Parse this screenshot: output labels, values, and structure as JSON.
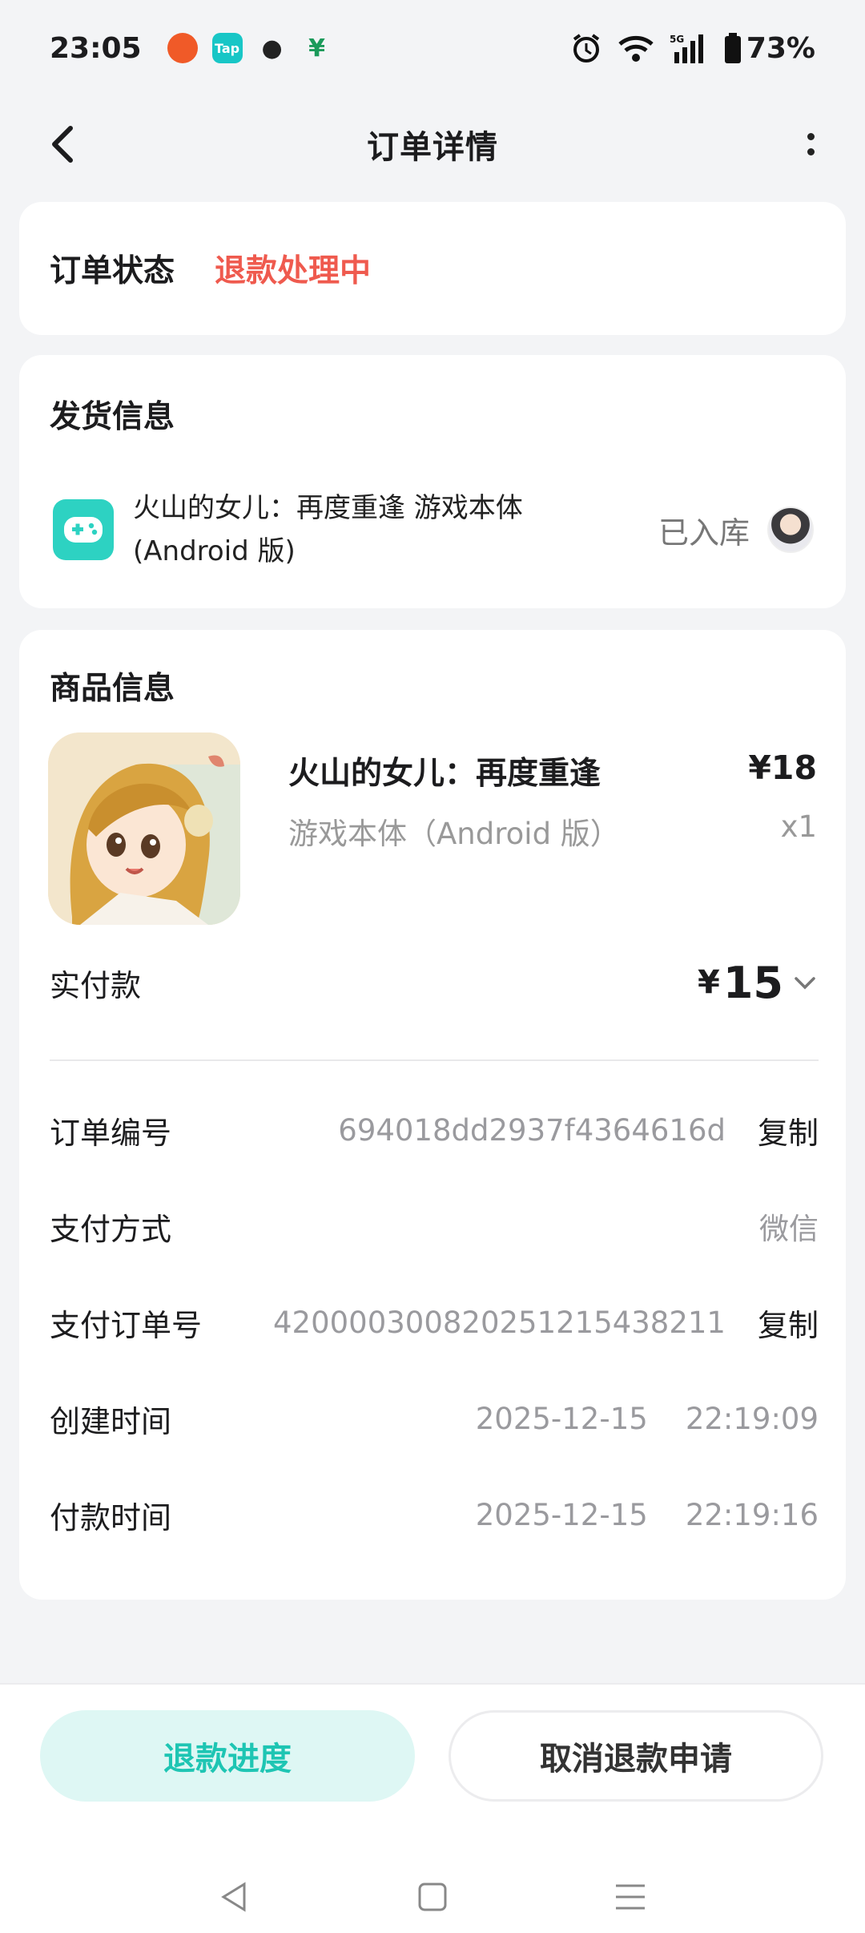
{
  "statusbar": {
    "time": "23:05",
    "battery": "73%",
    "network": "5G"
  },
  "header": {
    "title": "订单详情"
  },
  "order_status": {
    "label": "订单状态",
    "value": "退款处理中"
  },
  "shipping": {
    "title": "发货信息",
    "item_name_line1": "火山的女儿：再度重逢 游戏本体",
    "item_name_line2": "(Android 版)",
    "state": "已入库"
  },
  "goods": {
    "title": "商品信息",
    "name": "火山的女儿：再度重逢",
    "sku": "游戏本体（Android 版）",
    "price": "¥18",
    "qty": "x1"
  },
  "paid": {
    "label": "实付款",
    "currency": "¥",
    "amount": "15"
  },
  "details": {
    "order_no_label": "订单编号",
    "order_no": "694018dd2937f4364616d",
    "copy": "复制",
    "pay_method_label": "支付方式",
    "pay_method": "微信",
    "pay_order_label": "支付订单号",
    "pay_order_no": "420000300820251215438211",
    "created_label": "创建时间",
    "created": "2025-12-15    22:19:09",
    "paid_time_label": "付款时间",
    "paid_time": "2025-12-15    22:19:16"
  },
  "actions": {
    "primary": "退款进度",
    "secondary": "取消退款申请"
  },
  "colors": {
    "accent": "#1ec5b3",
    "status_red": "#ef5a4e",
    "app_icon": "#2dd2c2"
  }
}
